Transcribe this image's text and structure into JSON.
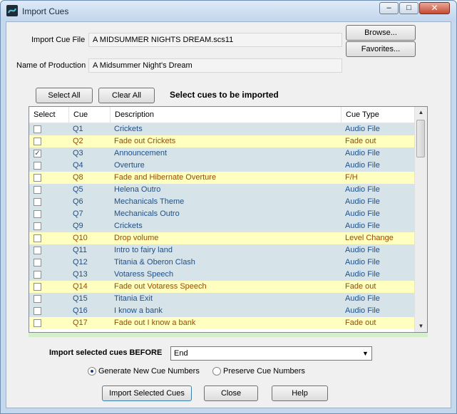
{
  "window": {
    "title": "Import Cues",
    "close_glyph": "✕",
    "min_glyph": "–",
    "max_glyph": "□"
  },
  "form": {
    "import_cue_file_label": "Import Cue File",
    "import_cue_file_value": "A MIDSUMMER NIGHTS DREAM.scs11",
    "production_label": "Name of Production",
    "production_value": "A Midsummer Night's Dream",
    "browse_label": "Browse...",
    "favorites_label": "Favorites..."
  },
  "selection": {
    "select_all_label": "Select All",
    "clear_all_label": "Clear All",
    "heading": "Select cues to be imported"
  },
  "table": {
    "columns": [
      "Select",
      "Cue",
      "Description",
      "Cue Type"
    ],
    "rows": [
      {
        "checked": false,
        "cue": "Q1",
        "description": "Crickets",
        "type": "Audio File",
        "highlight": false
      },
      {
        "checked": false,
        "cue": "Q2",
        "description": "Fade out Crickets",
        "type": "Fade out",
        "highlight": true
      },
      {
        "checked": true,
        "cue": "Q3",
        "description": "Announcement",
        "type": "Audio File",
        "highlight": false
      },
      {
        "checked": false,
        "cue": "Q4",
        "description": "Overture",
        "type": "Audio File",
        "highlight": false
      },
      {
        "checked": false,
        "cue": "Q8",
        "description": "Fade and Hibernate Overture",
        "type": "F/H",
        "highlight": true
      },
      {
        "checked": false,
        "cue": "Q5",
        "description": "Helena Outro",
        "type": "Audio File",
        "highlight": false
      },
      {
        "checked": false,
        "cue": "Q6",
        "description": "Mechanicals Theme",
        "type": "Audio File",
        "highlight": false
      },
      {
        "checked": false,
        "cue": "Q7",
        "description": "Mechanicals Outro",
        "type": "Audio File",
        "highlight": false
      },
      {
        "checked": false,
        "cue": "Q9",
        "description": "Crickets",
        "type": "Audio File",
        "highlight": false
      },
      {
        "checked": false,
        "cue": "Q10",
        "description": "Drop volume",
        "type": "Level Change",
        "highlight": true
      },
      {
        "checked": false,
        "cue": "Q11",
        "description": "Intro to fairy land",
        "type": "Audio File",
        "highlight": false
      },
      {
        "checked": false,
        "cue": "Q12",
        "description": "Titania & Oberon Clash",
        "type": "Audio File",
        "highlight": false
      },
      {
        "checked": false,
        "cue": "Q13",
        "description": "Votaress Speech",
        "type": "Audio File",
        "highlight": false
      },
      {
        "checked": false,
        "cue": "Q14",
        "description": "Fade out Votaress Speech",
        "type": "Fade out",
        "highlight": true
      },
      {
        "checked": false,
        "cue": "Q15",
        "description": "Titania Exit",
        "type": "Audio File",
        "highlight": false
      },
      {
        "checked": false,
        "cue": "Q16",
        "description": "I know a bank",
        "type": "Audio File",
        "highlight": false
      },
      {
        "checked": false,
        "cue": "Q17",
        "description": "Fade out I know a bank",
        "type": "Fade out",
        "highlight": true
      }
    ],
    "colors": {
      "audio_row_bg": "#d6e4ea",
      "audio_row_text": "#1f4f86",
      "highlight_row_bg": "#ffffc0",
      "highlight_row_text": "#9a4b00"
    }
  },
  "options": {
    "import_before_label": "Import selected cues BEFORE",
    "import_before_value": "End",
    "generate_label": "Generate New Cue Numbers",
    "preserve_label": "Preserve Cue Numbers",
    "generate_selected": true
  },
  "buttons": {
    "import_label": "Import Selected Cues",
    "close_label": "Close",
    "help_label": "Help"
  }
}
